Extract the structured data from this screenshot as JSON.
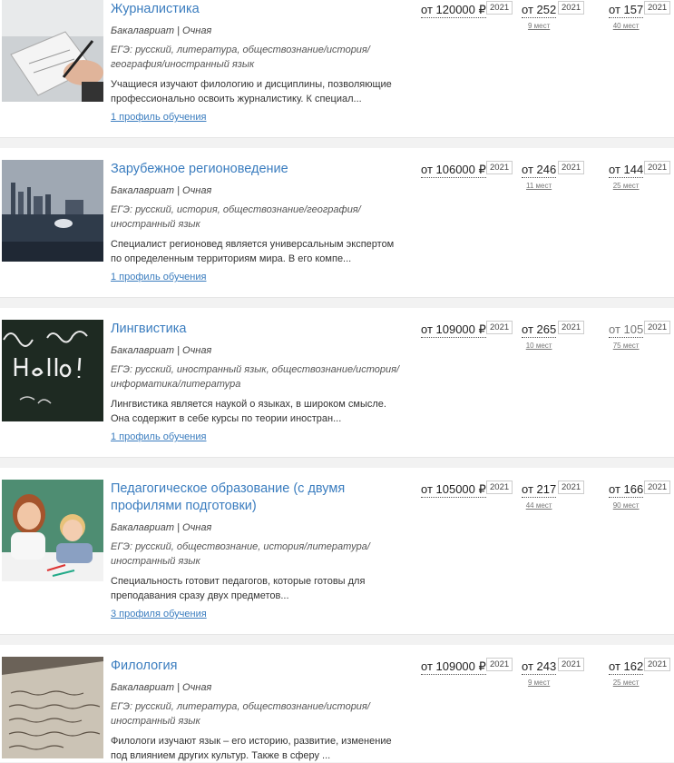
{
  "programs": [
    {
      "title": "Журналистика",
      "level": "Бакалавриат | Очная",
      "exams": "ЕГЭ: русский, литература, обществознание/история/ география/иностранный язык",
      "description": "Учащиеся изучают филологию и дисциплины, позволяющие профессионально освоить журналистику. К специал...",
      "profiles": "1 профиль обучения",
      "price": "от 120000 ₽",
      "price_year": "2021",
      "budget_score": "от 252",
      "budget_year": "2021",
      "budget_places": "9 мест",
      "paid_score": "от 157",
      "paid_year": "2021",
      "paid_places": "40 мест",
      "image_icon": "writing-hand-image"
    },
    {
      "title": "Зарубежное регионоведение",
      "level": "Бакалавриат | Очная",
      "exams": "ЕГЭ: русский, история, обществознание/география/ иностранный язык",
      "description": "Специалист регионовед является универсальным экспертом по определенным территориям мира. В его компе...",
      "profiles": "1 профиль обучения",
      "price": "от 106000 ₽",
      "price_year": "2021",
      "budget_score": "от 246",
      "budget_year": "2021",
      "budget_places": "11 мест",
      "paid_score": "от 144",
      "paid_year": "2021",
      "paid_places": "25 мест",
      "image_icon": "city-harbor-image"
    },
    {
      "title": "Лингвистика",
      "level": "Бакалавриат | Очная",
      "exams": "ЕГЭ: русский, иностранный язык, обществознание/история/ информатика/литература",
      "description": "Лингвистика является наукой о языках, в широком смысле. Она содержит в себе курсы по теории иностран...",
      "profiles": "1 профиль обучения",
      "price": "от 109000 ₽",
      "price_year": "2021",
      "budget_score": "от 265",
      "budget_year": "2021",
      "budget_places": "10 мест",
      "paid_score": "от 105",
      "paid_year": "2021",
      "paid_places": "75 мест",
      "image_icon": "chalkboard-image"
    },
    {
      "title": "Педагогическое образование (с двумя профилями подготовки)",
      "level": "Бакалавриат | Очная",
      "exams": "ЕГЭ: русский, обществознание, история/литература/ иностранный язык",
      "description": "Специальность готовит педагогов, которые готовы для преподавания сразу двух предметов...",
      "profiles": "3 профиля обучения",
      "price": "от 105000 ₽",
      "price_year": "2021",
      "budget_score": "от 217",
      "budget_year": "2021",
      "budget_places": "44 мест",
      "paid_score": "от 166",
      "paid_year": "2021",
      "paid_places": "90 мест",
      "image_icon": "teacher-child-image"
    },
    {
      "title": "Филология",
      "level": "Бакалавриат | Очная",
      "exams": "ЕГЭ: русский, литература, обществознание/история/ иностранный язык",
      "description": "Филологи изучают язык – его историю, развитие, изменение под влиянием других культур. Также в сферу ...",
      "profiles": "",
      "price": "от 109000 ₽",
      "price_year": "2021",
      "budget_score": "от 243",
      "budget_year": "2021",
      "budget_places": "9 мест",
      "paid_score": "от 162",
      "paid_year": "2021",
      "paid_places": "25 мест",
      "image_icon": "manuscript-image"
    }
  ]
}
